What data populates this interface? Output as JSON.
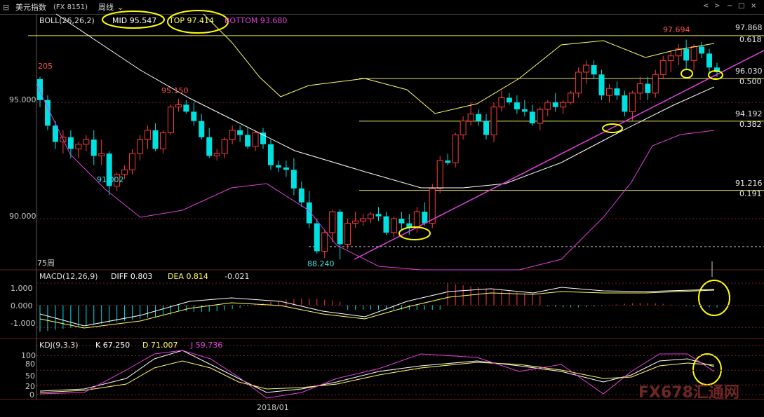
{
  "window": {
    "title": "美元指数",
    "code": "(FX 8151)",
    "period": "周线",
    "controls": [
      "<",
      ">",
      "−",
      "□",
      "×"
    ]
  },
  "boll": {
    "name": "BOLL(26,26,2)",
    "mid": "MID 95.547",
    "top": "TOP 97.414",
    "bottom": "BOTTOM 93.680"
  },
  "price_axis": {
    "ticks": [
      "95.000",
      "90.000"
    ]
  },
  "fib_levels": [
    {
      "price": "97.868",
      "ratio": "0.618"
    },
    {
      "price": "96.030",
      "ratio": "0.500"
    },
    {
      "price": "94.192",
      "ratio": "0.382"
    },
    {
      "price": "91.216",
      "ratio": "0.191"
    }
  ],
  "price_annotations": [
    "205",
    "95.150",
    "91.002",
    "88.240",
    "97.694"
  ],
  "ma_label": "75周",
  "macd": {
    "name": "MACD(12,26,9)",
    "diff": "DIFF 0.803",
    "dea": "DEA 0.814",
    "macd": "-0.021",
    "ticks": [
      "1.000",
      "0.000",
      "-1.000"
    ]
  },
  "kdj": {
    "name": "KDJ(9,3,3)",
    "k": "K 67.250",
    "d": "D 71.007",
    "j": "J 59.736",
    "ticks": [
      "100",
      "80",
      "50",
      "20",
      "0"
    ]
  },
  "date_label": "2018/01",
  "watermark": "FX678汇通网",
  "colors": {
    "up": "#ff3b3b",
    "down": "#00e0e0",
    "mid": "#ffffff",
    "top": "#ffff66",
    "bottom": "#e040e0",
    "fib": "#e0e060",
    "highlight": "#ffff00"
  },
  "chart_data": {
    "type": "candlestick",
    "title": "美元指数 (FX 8151) 周线",
    "candles": [
      [
        96.0,
        96.1,
        94.8,
        95.1
      ],
      [
        95.1,
        95.3,
        93.8,
        94.0
      ],
      [
        94.0,
        94.2,
        93.0,
        93.3
      ],
      [
        93.3,
        93.8,
        92.8,
        93.5
      ],
      [
        93.5,
        93.8,
        92.6,
        93.0
      ],
      [
        93.0,
        93.3,
        92.6,
        93.2
      ],
      [
        93.2,
        93.6,
        92.9,
        93.4
      ],
      [
        93.4,
        93.8,
        92.3,
        92.7
      ],
      [
        92.7,
        93.4,
        92.3,
        92.8
      ],
      [
        92.8,
        92.9,
        91.0,
        91.4
      ],
      [
        91.4,
        92.0,
        91.2,
        91.9
      ],
      [
        91.9,
        92.3,
        91.7,
        92.1
      ],
      [
        92.1,
        93.0,
        91.9,
        92.8
      ],
      [
        92.8,
        93.6,
        92.5,
        93.4
      ],
      [
        93.4,
        94.0,
        93.0,
        93.8
      ],
      [
        93.8,
        94.1,
        92.9,
        93.0
      ],
      [
        93.0,
        93.8,
        92.8,
        93.7
      ],
      [
        93.7,
        94.9,
        93.6,
        94.8
      ],
      [
        94.8,
        95.15,
        94.6,
        94.9
      ],
      [
        94.9,
        95.1,
        94.5,
        94.6
      ],
      [
        94.6,
        95.0,
        94.0,
        94.2
      ],
      [
        94.2,
        94.5,
        93.4,
        93.5
      ],
      [
        93.5,
        93.9,
        92.6,
        92.7
      ],
      [
        92.7,
        93.0,
        92.5,
        92.8
      ],
      [
        92.8,
        93.5,
        92.6,
        93.4
      ],
      [
        93.4,
        94.0,
        93.2,
        93.8
      ],
      [
        93.8,
        94.0,
        93.3,
        93.6
      ],
      [
        93.6,
        93.9,
        93.0,
        93.1
      ],
      [
        93.1,
        93.8,
        92.9,
        93.7
      ],
      [
        93.7,
        93.9,
        93.0,
        93.2
      ],
      [
        93.2,
        93.4,
        92.1,
        92.3
      ],
      [
        92.3,
        92.5,
        92.0,
        92.2
      ],
      [
        92.2,
        92.5,
        91.8,
        92.1
      ],
      [
        92.1,
        92.6,
        91.0,
        91.3
      ],
      [
        91.3,
        91.6,
        90.5,
        90.7
      ],
      [
        90.7,
        91.2,
        89.6,
        89.8
      ],
      [
        89.8,
        90.0,
        88.5,
        88.6
      ],
      [
        88.6,
        89.5,
        88.3,
        89.4
      ],
      [
        89.4,
        90.4,
        89.0,
        90.3
      ],
      [
        90.3,
        90.4,
        88.24,
        88.9
      ],
      [
        88.9,
        90.0,
        88.7,
        89.8
      ],
      [
        89.8,
        90.3,
        89.6,
        89.9
      ],
      [
        89.9,
        90.2,
        89.7,
        90.0
      ],
      [
        90.0,
        90.3,
        89.8,
        90.2
      ],
      [
        90.2,
        90.5,
        89.9,
        90.1
      ],
      [
        90.1,
        90.3,
        89.3,
        89.4
      ],
      [
        89.4,
        90.1,
        89.2,
        90.0
      ],
      [
        90.0,
        90.3,
        89.5,
        89.8
      ],
      [
        89.8,
        90.2,
        89.3,
        89.6
      ],
      [
        89.6,
        90.5,
        89.4,
        90.3
      ],
      [
        90.3,
        90.7,
        89.7,
        89.8
      ],
      [
        89.8,
        91.5,
        89.6,
        91.3
      ],
      [
        91.3,
        92.7,
        91.1,
        92.5
      ],
      [
        92.5,
        92.8,
        92.3,
        92.4
      ],
      [
        92.4,
        93.7,
        92.2,
        93.6
      ],
      [
        93.6,
        94.4,
        93.4,
        94.2
      ],
      [
        94.2,
        95.0,
        94.0,
        94.5
      ],
      [
        94.5,
        94.7,
        94.0,
        94.2
      ],
      [
        94.2,
        94.5,
        93.4,
        93.6
      ],
      [
        93.6,
        95.0,
        93.3,
        94.8
      ],
      [
        94.8,
        95.5,
        94.6,
        95.2
      ],
      [
        95.2,
        95.4,
        94.9,
        95.0
      ],
      [
        95.0,
        95.3,
        94.5,
        94.7
      ],
      [
        94.7,
        95.1,
        94.4,
        94.6
      ],
      [
        94.6,
        94.9,
        94.0,
        94.1
      ],
      [
        94.1,
        94.8,
        93.8,
        94.7
      ],
      [
        94.7,
        95.1,
        94.4,
        95.0
      ],
      [
        95.0,
        95.4,
        94.6,
        94.8
      ],
      [
        94.8,
        95.1,
        94.5,
        95.0
      ],
      [
        95.0,
        95.5,
        94.9,
        95.4
      ],
      [
        95.4,
        96.5,
        95.2,
        96.3
      ],
      [
        96.3,
        96.8,
        95.8,
        96.6
      ],
      [
        96.6,
        96.8,
        96.0,
        96.2
      ],
      [
        96.2,
        96.4,
        95.1,
        95.3
      ],
      [
        95.3,
        95.8,
        95.0,
        95.6
      ],
      [
        95.6,
        95.9,
        95.1,
        95.3
      ],
      [
        95.3,
        95.5,
        94.4,
        94.6
      ],
      [
        94.6,
        95.5,
        94.2,
        95.4
      ],
      [
        95.4,
        96.1,
        95.1,
        95.8
      ],
      [
        95.8,
        96.1,
        95.1,
        95.4
      ],
      [
        95.4,
        96.4,
        95.2,
        96.2
      ],
      [
        96.2,
        97.0,
        96.0,
        96.8
      ],
      [
        96.8,
        97.2,
        96.3,
        97.0
      ],
      [
        97.0,
        97.5,
        96.6,
        97.3
      ],
      [
        97.3,
        97.694,
        96.4,
        96.8
      ],
      [
        96.8,
        97.5,
        96.4,
        97.4
      ],
      [
        97.4,
        97.6,
        96.9,
        97.1
      ],
      [
        97.1,
        97.3,
        96.3,
        96.5
      ],
      [
        96.5,
        96.7,
        96.1,
        96.3
      ]
    ],
    "ylim": [
      87.8,
      98.8
    ],
    "lines": {
      "top_band_anchor_97.414": true
    },
    "macd_ylim": [
      -1.5,
      1.6
    ],
    "kdj_ylim": [
      -10,
      115
    ],
    "kdj_ticks": [
      0,
      20,
      50,
      80,
      100
    ]
  }
}
